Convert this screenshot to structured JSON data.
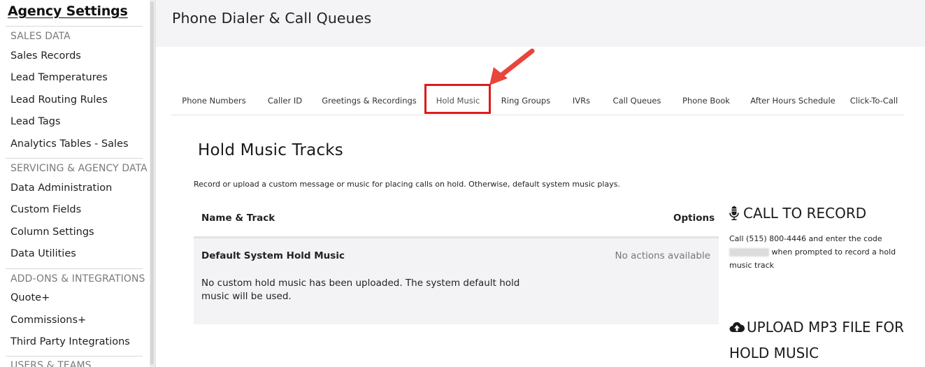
{
  "sidebar": {
    "title": "Agency Settings",
    "sections": [
      {
        "label": "SALES DATA",
        "items": [
          "Sales Records",
          "Lead Temperatures",
          "Lead Routing Rules",
          "Lead Tags",
          "Analytics Tables - Sales"
        ]
      },
      {
        "label": "SERVICING & AGENCY DATA",
        "items": [
          "Data Administration",
          "Custom Fields",
          "Column Settings",
          "Data Utilities"
        ]
      },
      {
        "label": "ADD-ONS & INTEGRATIONS",
        "items": [
          "Quote+",
          "Commissions+",
          "Third Party Integrations"
        ]
      },
      {
        "label": "USERS & TEAMS",
        "items": []
      }
    ]
  },
  "header": {
    "title": "Phone Dialer & Call Queues"
  },
  "tabs": [
    {
      "label": "Phone Numbers",
      "active": false
    },
    {
      "label": "Caller ID",
      "active": false
    },
    {
      "label": "Greetings & Recordings",
      "active": false
    },
    {
      "label": "Hold Music",
      "active": true
    },
    {
      "label": "Ring Groups",
      "active": false
    },
    {
      "label": "IVRs",
      "active": false
    },
    {
      "label": "Call Queues",
      "active": false
    },
    {
      "label": "Phone Book",
      "active": false
    },
    {
      "label": "After Hours Schedule",
      "active": false
    },
    {
      "label": "Click-To-Call",
      "active": false
    }
  ],
  "content": {
    "title": "Hold Music Tracks",
    "description": "Record or upload a custom message or music for placing calls on hold. Otherwise, default system music plays.",
    "table": {
      "headers": {
        "name": "Name & Track",
        "options": "Options"
      },
      "rows": [
        {
          "name": "Default System Hold Music",
          "options": "No actions available",
          "description": "No custom hold music has been uploaded. The system default hold music will be used."
        }
      ]
    }
  },
  "right_panel": {
    "call_title": "CALL TO RECORD",
    "call_text_1": "Call (515) 800-4446 and enter the code",
    "call_text_2": "when prompted to record a hold music track",
    "upload_title": "UPLOAD MP3 FILE FOR HOLD MUSIC"
  },
  "colors": {
    "highlight": "#dd1c1c",
    "arrow": "#e8453c",
    "header_bg": "#f4f4f6",
    "row_bg": "#f3f3f5"
  },
  "icons": [
    "microphone-icon",
    "cloud-upload-icon",
    "arrow-pointer"
  ]
}
